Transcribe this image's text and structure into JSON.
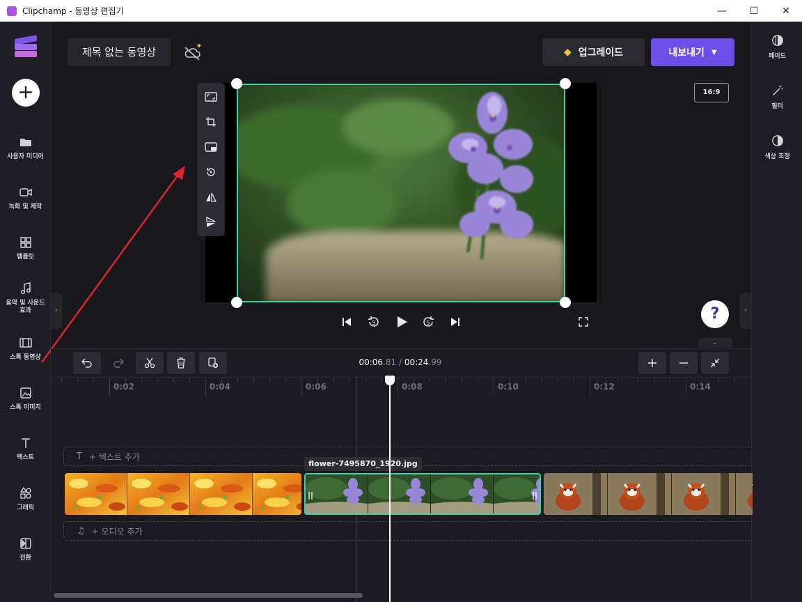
{
  "window": {
    "title": "Clipchamp - 동영상 편집기",
    "minimize": "—",
    "maximize": "☐",
    "close": "✕"
  },
  "left_nav": {
    "add": "+",
    "items": [
      {
        "label": "사용자 미디어",
        "icon": "folder-icon"
      },
      {
        "label": "녹화 및 제작",
        "icon": "camera-icon"
      },
      {
        "label": "템플릿",
        "icon": "template-icon"
      },
      {
        "label": "음악 및 사운드 효과",
        "icon": "music-note-icon"
      },
      {
        "label": "스톡 동영상",
        "icon": "film-icon"
      },
      {
        "label": "스톡 이미지",
        "icon": "image-icon"
      },
      {
        "label": "텍스트",
        "icon": "text-icon"
      },
      {
        "label": "그래픽",
        "icon": "shapes-icon"
      },
      {
        "label": "전환",
        "icon": "transition-icon"
      }
    ]
  },
  "right_nav": {
    "items": [
      {
        "label": "페이드",
        "icon": "fade-icon"
      },
      {
        "label": "필터",
        "icon": "magic-wand-icon"
      },
      {
        "label": "색상 조정",
        "icon": "contrast-icon"
      }
    ]
  },
  "header": {
    "project_title": "제목 없는 동영상",
    "upgrade_label": "업그레이드",
    "export_label": "내보내기"
  },
  "preview": {
    "aspect_ratio": "16:9"
  },
  "timeline": {
    "current_time_main": "00:06",
    "current_time_frac": ".81",
    "separator": " / ",
    "total_time_main": "00:24",
    "total_time_frac": ".99",
    "ticks": [
      "0:02",
      "0:04",
      "0:06",
      "0:08",
      "0:10",
      "0:12",
      "0:14"
    ],
    "text_track_label": "+ 텍스트 추가",
    "audio_track_label": "+ 오디오 추가",
    "selected_clip_name": "flower-7495870_1920.jpg",
    "help": "?"
  },
  "colors": {
    "accent": "#6b4fe8",
    "selection": "#38d1a8",
    "annotation_arrow": "#e0242c"
  }
}
